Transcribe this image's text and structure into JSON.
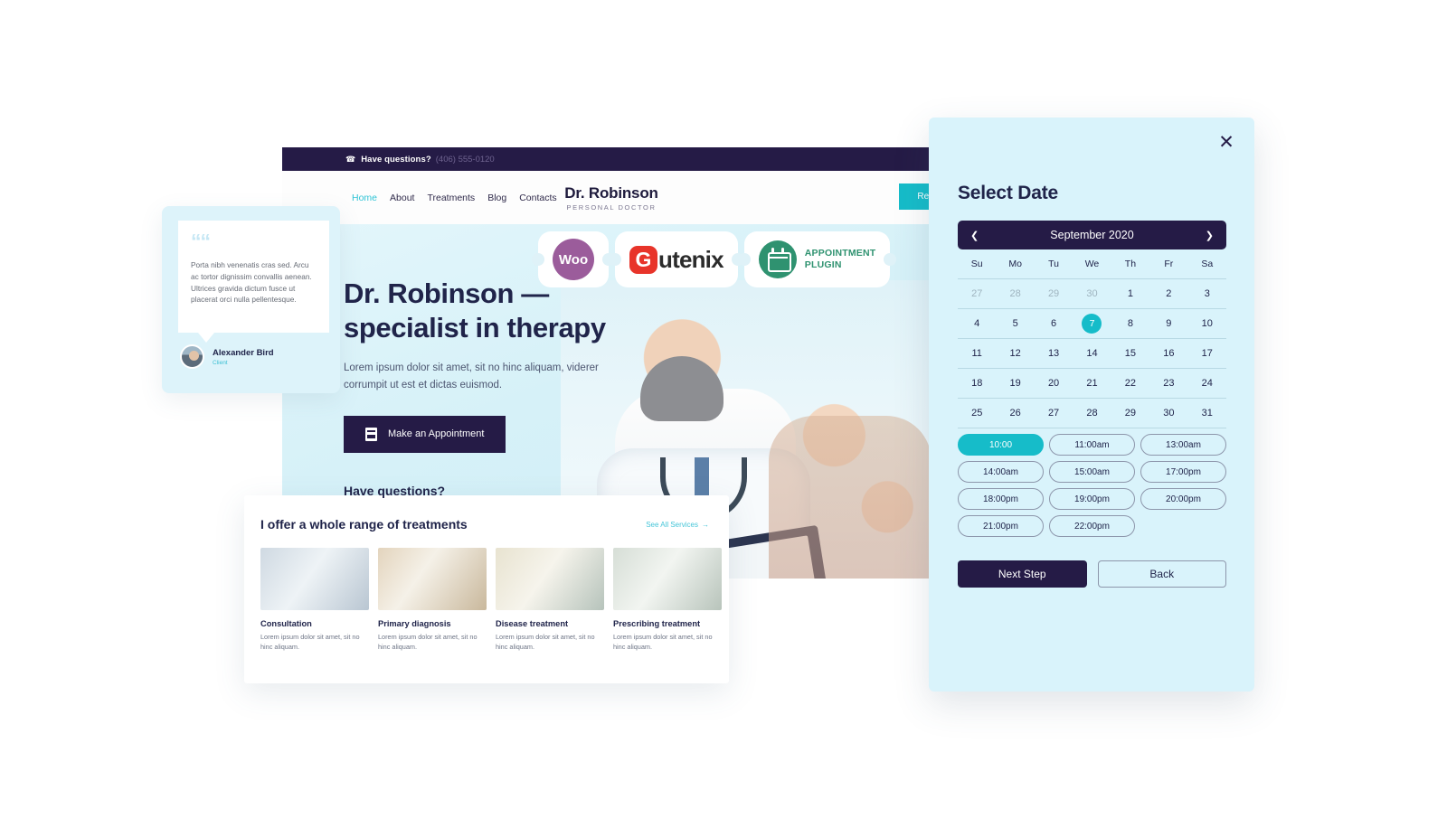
{
  "site": {
    "topbar": {
      "icon": "phone-icon",
      "label": "Have questions?",
      "phone": "(406) 555-0120"
    },
    "nav": {
      "items": [
        {
          "label": "Home",
          "active": true
        },
        {
          "label": "About",
          "active": false
        },
        {
          "label": "Treatments",
          "active": false
        },
        {
          "label": "Blog",
          "active": false
        },
        {
          "label": "Contacts",
          "active": false
        }
      ],
      "brand_title": "Dr. Robinson",
      "brand_sub": "PERSONAL DOCTOR",
      "cta_label": "Request a Call"
    },
    "hero": {
      "heading": "Dr. Robinson — specialist in therapy",
      "paragraph": "Lorem ipsum dolor sit amet, sit no hinc aliquam, viderer corrumpit ut est et dictas euismod.",
      "button_label": "Make an Appointment",
      "button_icon": "appointment-book-icon",
      "questions_label": "Have questions?"
    },
    "logos": [
      {
        "name": "woo-logo",
        "text": "Woo"
      },
      {
        "name": "gutenix-logo",
        "letter": "G",
        "rest": "utenix"
      },
      {
        "name": "appointment-plugin-logo",
        "line1": "APPOINTMENT",
        "line2": "PLUGIN",
        "icon": "calendar-icon"
      }
    ],
    "treatments": {
      "title": "I offer a whole range of treatments",
      "link_label": "See All Services",
      "link_arrow": "→",
      "cards": [
        {
          "name": "Consultation",
          "desc": "Lorem ipsum dolor sit amet, sit no hinc aliquam."
        },
        {
          "name": "Primary diagnosis",
          "desc": "Lorem ipsum dolor sit amet, sit no hinc aliquam."
        },
        {
          "name": "Disease treatment",
          "desc": "Lorem ipsum dolor sit amet, sit no hinc aliquam."
        },
        {
          "name": "Prescribing treatment",
          "desc": "Lorem ipsum dolor sit amet, sit no hinc aliquam."
        }
      ]
    }
  },
  "testimonial": {
    "quote_icon": "quote-mark-icon",
    "text": "Porta nibh venenatis cras sed. Arcu ac tortor dignissim convallis aenean. Ultrices gravida dictum fusce ut placerat orci nulla pellentesque.",
    "author": "Alexander Bird",
    "role": "Client"
  },
  "modal": {
    "close_icon": "close-icon",
    "title": "Select Date",
    "calendar": {
      "prev_icon": "chevron-left-icon",
      "next_icon": "chevron-right-icon",
      "month_label": "September 2020",
      "weekdays": [
        "Su",
        "Mo",
        "Tu",
        "We",
        "Th",
        "Fr",
        "Sa"
      ],
      "selected_day": 7,
      "weeks": [
        [
          {
            "d": "27",
            "muted": true
          },
          {
            "d": "28",
            "muted": true
          },
          {
            "d": "29",
            "muted": true
          },
          {
            "d": "30",
            "muted": true
          },
          {
            "d": "1",
            "muted": false
          },
          {
            "d": "2",
            "muted": false
          },
          {
            "d": "3",
            "muted": false
          }
        ],
        [
          {
            "d": "4",
            "muted": false
          },
          {
            "d": "5",
            "muted": false
          },
          {
            "d": "6",
            "muted": false
          },
          {
            "d": "7",
            "muted": false,
            "selected": true
          },
          {
            "d": "8",
            "muted": false
          },
          {
            "d": "9",
            "muted": false
          },
          {
            "d": "10",
            "muted": false
          }
        ],
        [
          {
            "d": "11",
            "muted": false
          },
          {
            "d": "12",
            "muted": false
          },
          {
            "d": "13",
            "muted": false
          },
          {
            "d": "14",
            "muted": false
          },
          {
            "d": "15",
            "muted": false
          },
          {
            "d": "16",
            "muted": false
          },
          {
            "d": "17",
            "muted": false
          }
        ],
        [
          {
            "d": "18",
            "muted": false
          },
          {
            "d": "19",
            "muted": false
          },
          {
            "d": "20",
            "muted": false
          },
          {
            "d": "21",
            "muted": false
          },
          {
            "d": "22",
            "muted": false
          },
          {
            "d": "23",
            "muted": false
          },
          {
            "d": "24",
            "muted": false
          }
        ],
        [
          {
            "d": "25",
            "muted": false
          },
          {
            "d": "26",
            "muted": false
          },
          {
            "d": "27",
            "muted": false
          },
          {
            "d": "28",
            "muted": false
          },
          {
            "d": "29",
            "muted": false
          },
          {
            "d": "30",
            "muted": false
          },
          {
            "d": "31",
            "muted": false
          }
        ]
      ]
    },
    "time_slots": [
      {
        "label": "10:00",
        "selected": true
      },
      {
        "label": "11:00am",
        "selected": false
      },
      {
        "label": "13:00am",
        "selected": false
      },
      {
        "label": "14:00am",
        "selected": false
      },
      {
        "label": "15:00am",
        "selected": false
      },
      {
        "label": "17:00pm",
        "selected": false
      },
      {
        "label": "18:00pm",
        "selected": false
      },
      {
        "label": "19:00pm",
        "selected": false
      },
      {
        "label": "20:00pm",
        "selected": false
      },
      {
        "label": "21:00pm",
        "selected": false
      },
      {
        "label": "22:00pm",
        "selected": false
      }
    ],
    "next_label": "Next Step",
    "back_label": "Back"
  },
  "colors": {
    "accent_cyan": "#16bcc9",
    "dark_navy": "#251b46",
    "modal_bg": "#d9f3fb",
    "woo_purple": "#9b5c9b",
    "gutenix_red": "#e8342a",
    "plugin_green": "#2f9270"
  }
}
